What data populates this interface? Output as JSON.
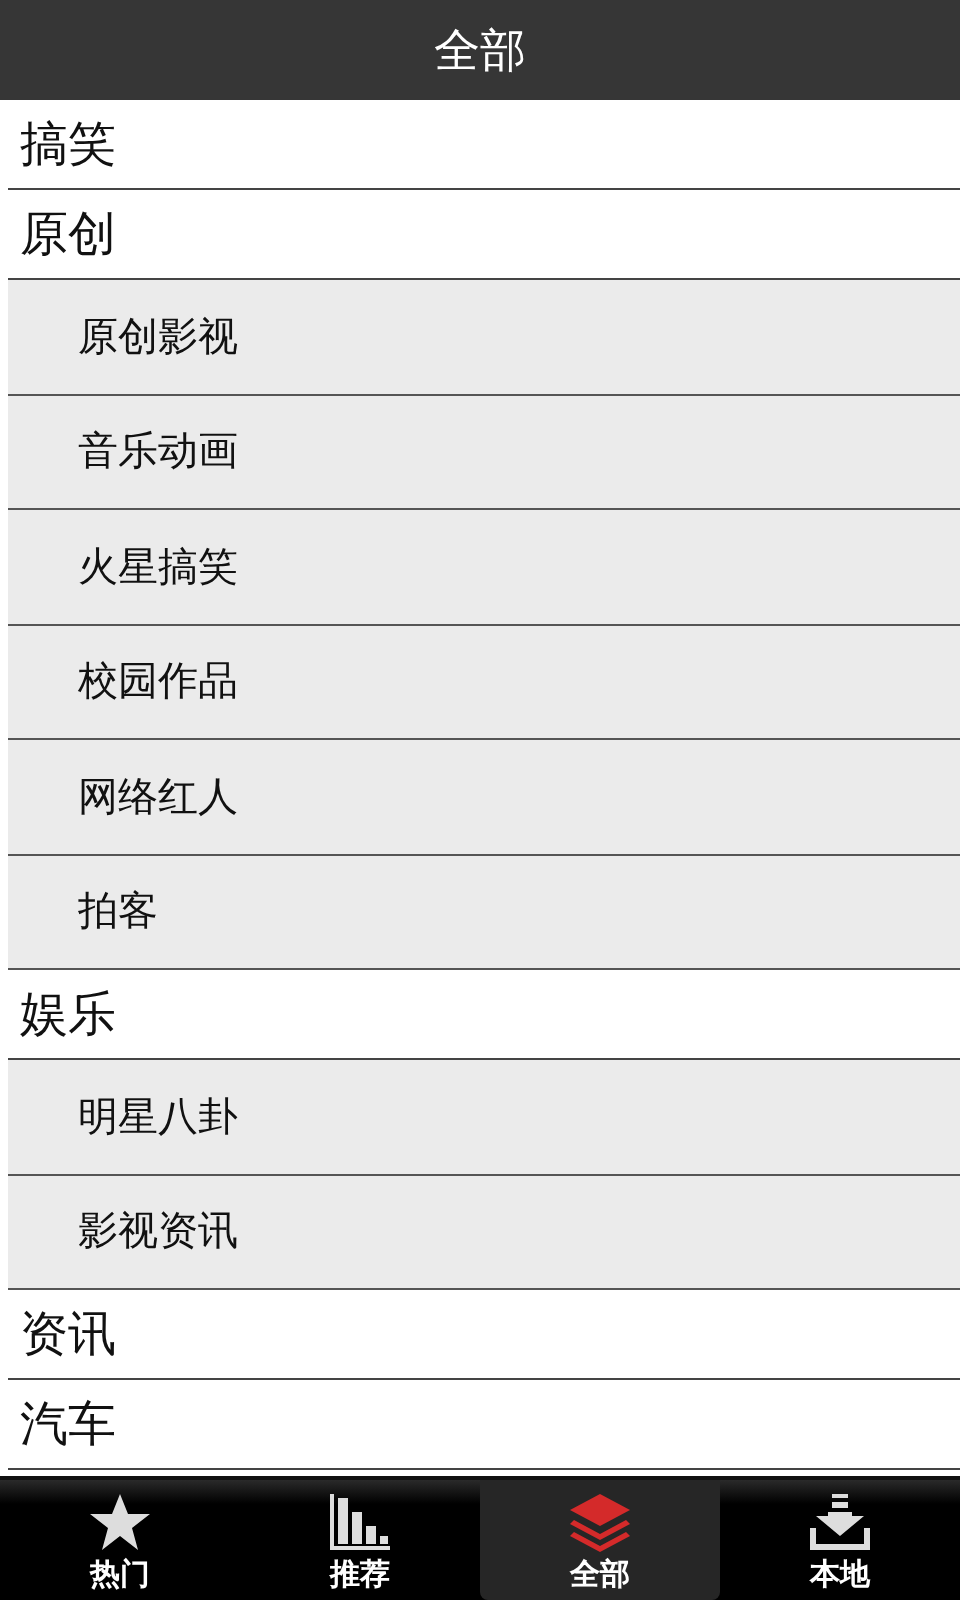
{
  "header": {
    "title": "全部"
  },
  "categories": [
    {
      "label": "搞笑"
    },
    {
      "label": "原创",
      "children": [
        {
          "label": "原创影视"
        },
        {
          "label": "音乐动画"
        },
        {
          "label": "火星搞笑"
        },
        {
          "label": "校园作品"
        },
        {
          "label": "网络红人"
        },
        {
          "label": "拍客"
        }
      ]
    },
    {
      "label": "娱乐",
      "children": [
        {
          "label": "明星八卦"
        },
        {
          "label": "影视资讯"
        }
      ]
    },
    {
      "label": "资讯"
    },
    {
      "label": "汽车"
    }
  ],
  "tabs": [
    {
      "kind": "star",
      "label": "热门",
      "selected": false
    },
    {
      "kind": "chart",
      "label": "推荐",
      "selected": false
    },
    {
      "kind": "layers",
      "label": "全部",
      "selected": true
    },
    {
      "kind": "download",
      "label": "本地",
      "selected": false
    }
  ]
}
